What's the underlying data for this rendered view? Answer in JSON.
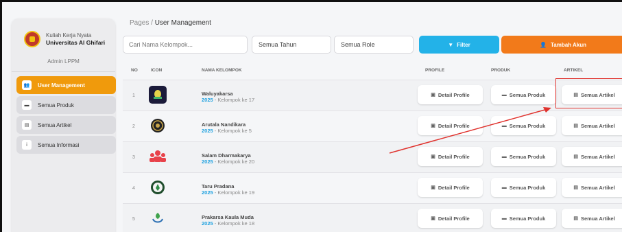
{
  "sidebar": {
    "brand_line1": "Kuliah Kerja Nyata",
    "brand_line2": "Universitas Al Ghifari",
    "role": "Admin LPPM",
    "items": [
      {
        "label": "User Management",
        "icon": "users-icon",
        "glyph": "👥",
        "active": true
      },
      {
        "label": "Semua Produk",
        "icon": "product-icon",
        "glyph": "▬",
        "active": false
      },
      {
        "label": "Semua Artikel",
        "icon": "article-icon",
        "glyph": "▤",
        "active": false
      },
      {
        "label": "Semua Informasi",
        "icon": "info-icon",
        "glyph": "i",
        "active": false
      }
    ]
  },
  "breadcrumb": {
    "root": "Pages",
    "sep": "/",
    "current": "User Management"
  },
  "toolbar": {
    "search_placeholder": "Cari Nama Kelompok...",
    "year_select": "Semua Tahun",
    "role_select": "Semua Role",
    "filter_label": "Filter",
    "add_label": "Tambah Akun"
  },
  "table": {
    "headers": {
      "no": "NO",
      "icon": "ICON",
      "name": "NAMA KELOMPOK",
      "profile": "PROFILE",
      "produk": "PRODUK",
      "artikel": "ARTIKEL"
    },
    "rows": [
      {
        "no": "1",
        "name": "Waluyakarsa",
        "year": "2025",
        "group": " - Kelompok ke 17",
        "icon": "group-logo-icon",
        "profile": "Detail Profile",
        "produk": "Semua Produk",
        "artikel": "Semua Artikel"
      },
      {
        "no": "2",
        "name": "Arutala Nandikara",
        "year": "2025",
        "group": " - Kelompok ke 5",
        "icon": "group-logo-icon",
        "profile": "Detail Profile",
        "produk": "Semua Produk",
        "artikel": "Semua Artikel"
      },
      {
        "no": "3",
        "name": "Salam Dharmakarya",
        "year": "2025",
        "group": " - Kelompok ke 20",
        "icon": "group-logo-icon",
        "profile": "Detail Profile",
        "produk": "Semua Produk",
        "artikel": "Semua Artikel"
      },
      {
        "no": "4",
        "name": "Taru Pradana",
        "year": "2025",
        "group": " - Kelompok ke 19",
        "icon": "group-logo-icon",
        "profile": "Detail Profile",
        "produk": "Semua Produk",
        "artikel": "Semua Artikel"
      },
      {
        "no": "5",
        "name": "Prakarsa Kaula Muda",
        "year": "2025",
        "group": " - Kelompok ke 18",
        "icon": "group-logo-icon",
        "profile": "Detail Profile",
        "produk": "Semua Produk",
        "artikel": "Semua Artikel"
      }
    ]
  },
  "colors": {
    "accent": "#f09a0c",
    "filter": "#23b2e8",
    "add": "#f27a1a",
    "highlight": "#e0322d"
  }
}
